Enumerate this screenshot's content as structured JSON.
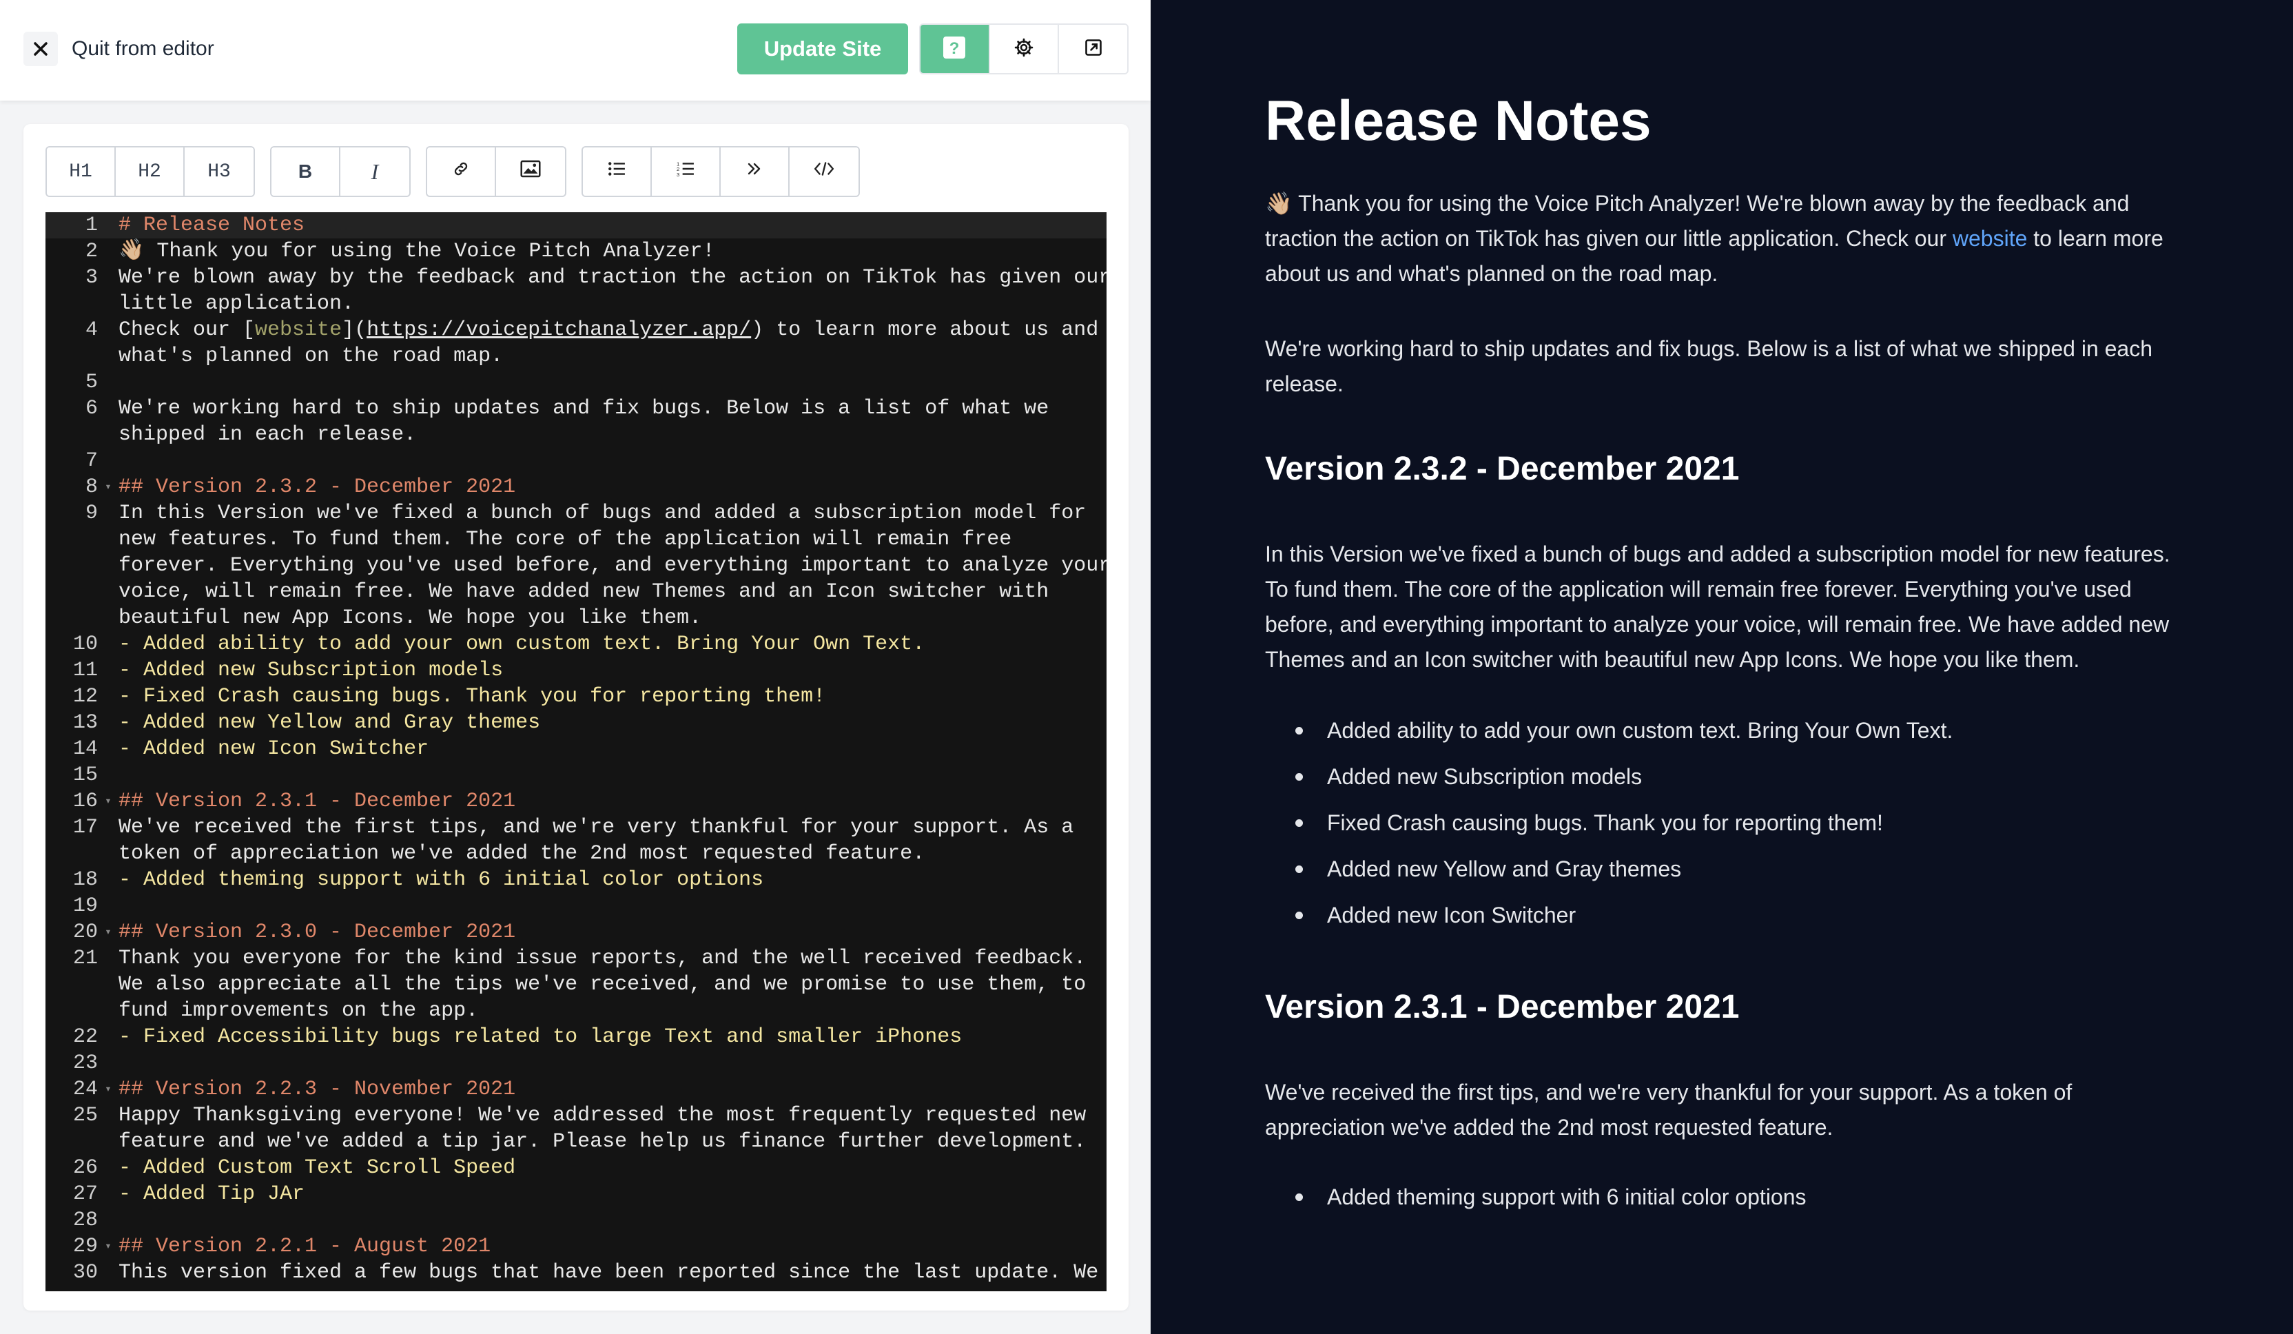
{
  "topbar": {
    "quit_label": "Quit from editor",
    "update_label": "Update Site",
    "tools": [
      "help-icon",
      "gear-icon",
      "external-link-icon"
    ],
    "accent": "#5fc495"
  },
  "format_toolbar": {
    "headings": [
      "H1",
      "H2",
      "H3"
    ],
    "bold": "B",
    "italic": "I",
    "insert": [
      "link-icon",
      "image-icon"
    ],
    "blocks": [
      "bullet-list-icon",
      "numbered-list-icon",
      "quote-icon",
      "code-icon"
    ]
  },
  "editor": {
    "lines": [
      {
        "n": "1",
        "fold": false,
        "type": "head",
        "text": [
          "# Release Notes"
        ]
      },
      {
        "n": "2",
        "fold": false,
        "type": "plain",
        "text": [
          "👋🏼 Thank you for using the Voice Pitch Analyzer!"
        ]
      },
      {
        "n": "3",
        "fold": false,
        "type": "plain",
        "text": [
          "We're blown away by the feedback and traction the action on TikTok has given our",
          "little application."
        ]
      },
      {
        "n": "4",
        "fold": false,
        "type": "link",
        "before": "Check our [",
        "link": "website",
        "mid": "](",
        "url": "https://voicepitchanalyzer.app/",
        "after": ") to learn more about us and",
        "text2": "what's planned on the road map."
      },
      {
        "n": "5",
        "fold": false,
        "type": "plain",
        "text": [
          ""
        ]
      },
      {
        "n": "6",
        "fold": false,
        "type": "plain",
        "text": [
          "We're working hard to ship updates and fix bugs. Below is a list of what we",
          "shipped in each release."
        ]
      },
      {
        "n": "7",
        "fold": false,
        "type": "plain",
        "text": [
          ""
        ]
      },
      {
        "n": "8",
        "fold": true,
        "type": "head",
        "text": [
          "## Version 2.3.2 - December 2021"
        ]
      },
      {
        "n": "9",
        "fold": false,
        "type": "plain",
        "text": [
          "In this Version we've fixed a bunch of bugs and added a subscription model for",
          "new features. To fund them. The core of the application will remain free",
          "forever. Everything you've used before, and everything important to analyze your",
          "voice, will remain free. We have added new Themes and an Icon switcher with",
          "beautiful new App Icons. We hope you like them."
        ]
      },
      {
        "n": "10",
        "fold": false,
        "type": "list",
        "text": [
          "- Added ability to add your own custom text. Bring Your Own Text."
        ]
      },
      {
        "n": "11",
        "fold": false,
        "type": "list",
        "text": [
          "- Added new Subscription models"
        ]
      },
      {
        "n": "12",
        "fold": false,
        "type": "list",
        "text": [
          "- Fixed Crash causing bugs. Thank you for reporting them!"
        ]
      },
      {
        "n": "13",
        "fold": false,
        "type": "list",
        "text": [
          "- Added new Yellow and Gray themes"
        ]
      },
      {
        "n": "14",
        "fold": false,
        "type": "list",
        "text": [
          "- Added new Icon Switcher"
        ]
      },
      {
        "n": "15",
        "fold": false,
        "type": "plain",
        "text": [
          ""
        ]
      },
      {
        "n": "16",
        "fold": true,
        "type": "head",
        "text": [
          "## Version 2.3.1 - December 2021"
        ]
      },
      {
        "n": "17",
        "fold": false,
        "type": "plain",
        "text": [
          "We've received the first tips, and we're very thankful for your support. As a",
          "token of appreciation we've added the 2nd most requested feature."
        ]
      },
      {
        "n": "18",
        "fold": false,
        "type": "list",
        "text": [
          "- Added theming support with 6 initial color options"
        ]
      },
      {
        "n": "19",
        "fold": false,
        "type": "plain",
        "text": [
          ""
        ]
      },
      {
        "n": "20",
        "fold": true,
        "type": "head",
        "text": [
          "## Version 2.3.0 - December 2021"
        ]
      },
      {
        "n": "21",
        "fold": false,
        "type": "plain",
        "text": [
          "Thank you everyone for the kind issue reports, and the well received feedback.",
          "We also appreciate all the tips we've received, and we promise to use them, to",
          "fund improvements on the app."
        ]
      },
      {
        "n": "22",
        "fold": false,
        "type": "list",
        "text": [
          "- Fixed Accessibility bugs related to large Text and smaller iPhones"
        ]
      },
      {
        "n": "23",
        "fold": false,
        "type": "plain",
        "text": [
          ""
        ]
      },
      {
        "n": "24",
        "fold": true,
        "type": "head",
        "text": [
          "## Version 2.2.3 - November 2021"
        ]
      },
      {
        "n": "25",
        "fold": false,
        "type": "plain",
        "text": [
          "Happy Thanksgiving everyone! We've addressed the most frequently requested new",
          "feature and we've added a tip jar. Please help us finance further development."
        ]
      },
      {
        "n": "26",
        "fold": false,
        "type": "list",
        "text": [
          "- Added Custom Text Scroll Speed"
        ]
      },
      {
        "n": "27",
        "fold": false,
        "type": "list",
        "text": [
          "- Added Tip JAr"
        ]
      },
      {
        "n": "28",
        "fold": false,
        "type": "plain",
        "text": [
          ""
        ]
      },
      {
        "n": "29",
        "fold": true,
        "type": "head",
        "text": [
          "## Version 2.2.1 - August 2021"
        ]
      },
      {
        "n": "30",
        "fold": false,
        "type": "plain",
        "text": [
          "This version fixed a few bugs that have been reported since the last update. We"
        ]
      }
    ]
  },
  "preview": {
    "title": "Release Notes",
    "intro_before": "👋🏼 Thank you for using the Voice Pitch Analyzer! We're blown away by the feedback and traction the action on TikTok has given our little application. Check our ",
    "intro_link": "website",
    "intro_after": " to learn more about us and what's planned on the road map.",
    "para2": "We're working hard to ship updates and fix bugs. Below is a list of what we shipped in each release.",
    "v232_title": "Version 2.3.2 - December 2021",
    "v232_body": "In this Version we've fixed a bunch of bugs and added a subscription model for new features. To fund them. The core of the application will remain free forever. Everything you've used before, and everything important to analyze your voice, will remain free. We have added new Themes and an Icon switcher with beautiful new App Icons. We hope you like them.",
    "v232_items": [
      "Added ability to add your own custom text. Bring Your Own Text.",
      "Added new Subscription models",
      "Fixed Crash causing bugs. Thank you for reporting them!",
      "Added new Yellow and Gray themes",
      "Added new Icon Switcher"
    ],
    "v231_title": "Version 2.3.1 - December 2021",
    "v231_body": "We've received the first tips, and we're very thankful for your support. As a token of appreciation we've added the 2nd most requested feature.",
    "v231_items": [
      "Added theming support with 6 initial color options"
    ]
  }
}
